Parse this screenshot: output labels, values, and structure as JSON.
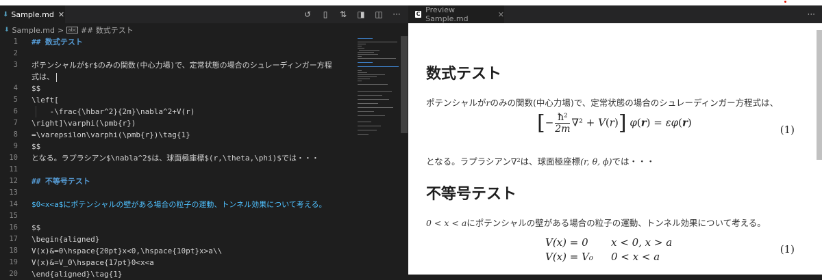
{
  "editor": {
    "tab_title": "Sample.md",
    "tab_close": "✕",
    "toolbar_more": "···",
    "breadcrumb": {
      "file": "Sample.md",
      "separator": ">",
      "section": "## 数式テスト"
    },
    "lines": [
      {
        "n": "1",
        "text": "## 数式テスト"
      },
      {
        "n": "2",
        "text": ""
      },
      {
        "n": "3",
        "text": "ポテンシャルが$r$のみの関数(中心力場)で、定常状態の場合のシュレーディンガー方程"
      },
      {
        "n": "",
        "text": "式は、"
      },
      {
        "n": "4",
        "text": "$$"
      },
      {
        "n": "5",
        "text": "\\left["
      },
      {
        "n": "6",
        "text": "    -\\frac{\\hbar^2}{2m}\\nabla^2+V(r)"
      },
      {
        "n": "7",
        "text": "\\right]\\varphi(\\pmb{r})"
      },
      {
        "n": "8",
        "text": "=\\varepsilon\\varphi(\\pmb{r})\\tag{1}"
      },
      {
        "n": "9",
        "text": "$$"
      },
      {
        "n": "10",
        "text": "となる。ラプラシアン$\\nabla^2$は、球面極座標$(r,\\theta,\\phi)$では・・・"
      },
      {
        "n": "11",
        "text": ""
      },
      {
        "n": "12",
        "text": "## 不等号テスト"
      },
      {
        "n": "13",
        "text": ""
      },
      {
        "n": "14",
        "text": "$0<x<a$にポテンシャルの壁がある場合の粒子の運動、トンネル効果について考える。"
      },
      {
        "n": "15",
        "text": ""
      },
      {
        "n": "16",
        "text": "$$"
      },
      {
        "n": "17",
        "text": "\\begin{aligned}"
      },
      {
        "n": "18",
        "text": "V(x)&=0\\hspace{20pt}x<0,\\hspace{10pt}x>a\\\\"
      },
      {
        "n": "19",
        "text": "V(x)&=V_0\\hspace{17pt}0<x<a"
      },
      {
        "n": "20",
        "text": "\\end{aligned}\\tag{1}"
      },
      {
        "n": "21",
        "text": "$$"
      }
    ]
  },
  "preview": {
    "tab_title": "Preview Sample.md",
    "tab_close": "✕",
    "more": "···",
    "h1": "数式テスト",
    "p1_prefix": "ポテンシャルが",
    "p1_var": "r",
    "p1_suffix": "のみの関数(中心力場)で、定常状態の場合のシュレーディンガー方程式は、",
    "eq1_num": "(1)",
    "p2_prefix": "となる。ラプラシアン",
    "p2_mid": "は、球面極座標",
    "p2_coords": "(r, θ, ϕ)",
    "p2_suffix": "では・・・",
    "h2": "不等号テスト",
    "p3_math": "0 < x < a",
    "p3_suffix": "にポテンシャルの壁がある場合の粒子の運動、トンネル効果について考える。",
    "eq2_line1_lhs": "V(x) = 0",
    "eq2_line1_rhs": "x < 0,   x > a",
    "eq2_line2_lhs": "V(x) = V₀",
    "eq2_line2_rhs": "0 < x < a",
    "eq2_num": "(1)"
  }
}
